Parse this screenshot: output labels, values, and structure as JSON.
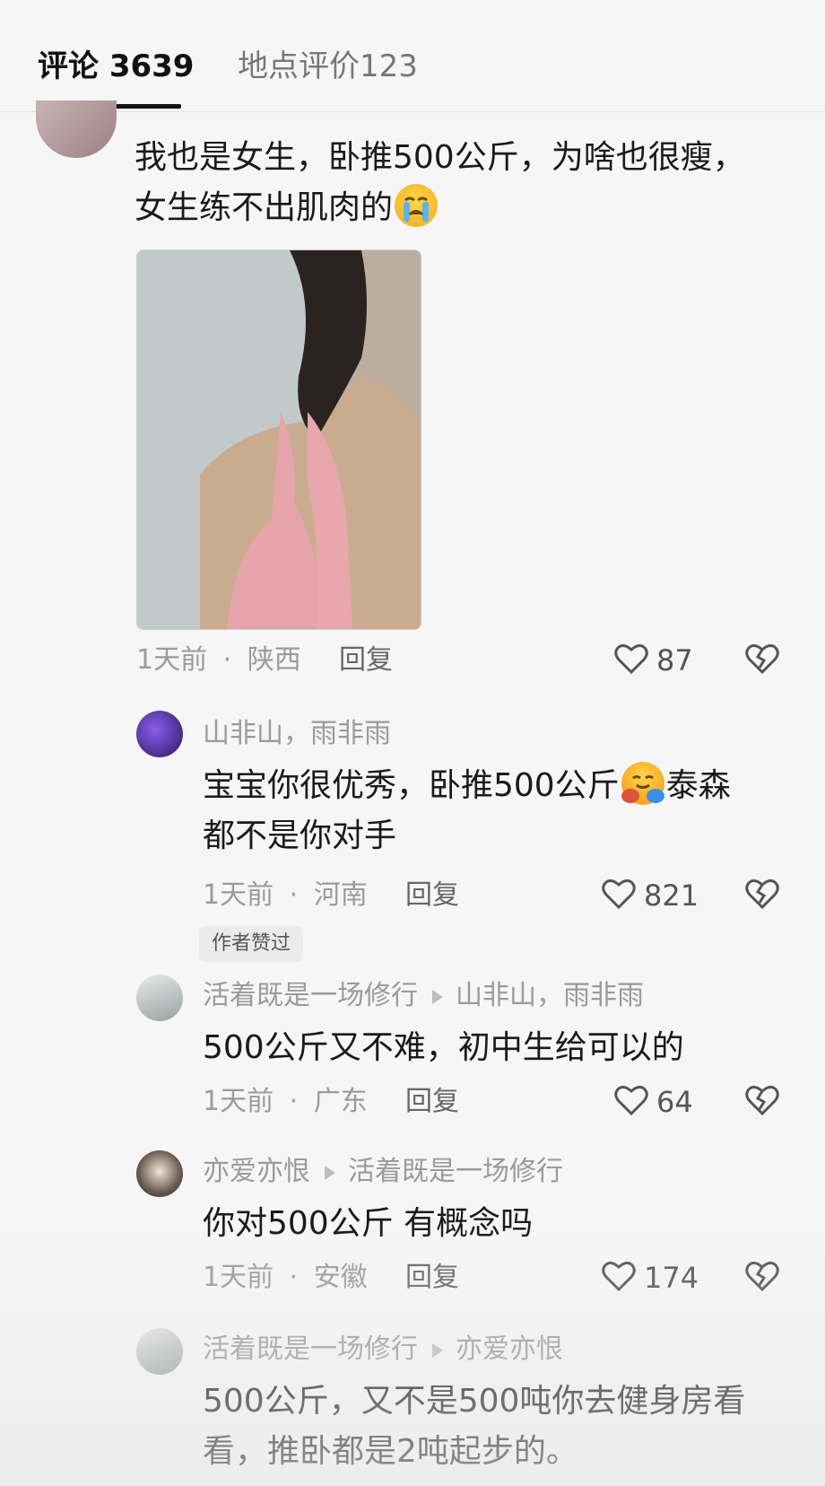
{
  "tabs": {
    "comments": "评论 3639",
    "location_reviews": "地点评价123"
  },
  "comments": [
    {
      "text_line1": "我也是女生，卧推500公斤，为啥也很瘦，",
      "text_line2": "女生练不出肌肉的",
      "emoji": "crying-face",
      "time": "1天前",
      "location": "陕西",
      "reply": "回复",
      "likes": "87"
    },
    {
      "username": "山非山，雨非雨",
      "text_line1a": "宝宝你很优秀，卧推500公斤",
      "emoji": "hugging-face",
      "text_line1b": "泰森",
      "text_line2": "都不是你对手",
      "time": "1天前",
      "location": "河南",
      "reply": "回复",
      "likes": "821",
      "badge": "作者赞过"
    },
    {
      "username": "活着既是一场修行",
      "reply_to": "山非山，雨非雨",
      "text": "500公斤又不难，初中生给可以的",
      "time": "1天前",
      "location": "广东",
      "reply": "回复",
      "likes": "64"
    },
    {
      "username": "亦爱亦恨",
      "reply_to": "活着既是一场修行",
      "text": "你对500公斤 有概念吗",
      "time": "1天前",
      "location": "安徽",
      "reply": "回复",
      "likes": "174"
    },
    {
      "username": "活着既是一场修行",
      "reply_to": "亦爱亦恨",
      "text_line1": "500公斤，又不是500吨你去健身房看",
      "text_line2": "看，推卧都是2吨起步的。"
    }
  ],
  "separator": "·",
  "colors": {
    "background": "#f6f6f6",
    "text": "#1b1b1b",
    "meta": "#9b9b9b"
  }
}
